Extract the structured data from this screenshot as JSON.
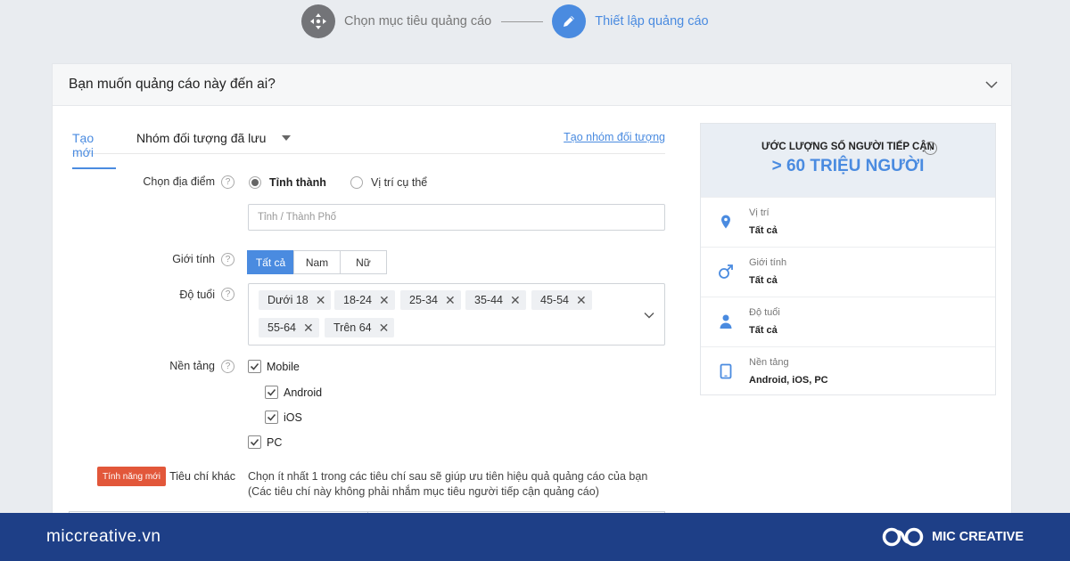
{
  "stepper": {
    "step1_label": "Chọn mục tiêu quảng cáo",
    "step2_label": "Thiết lập quảng cáo"
  },
  "card": {
    "title": "Bạn muốn quảng cáo này đến ai?"
  },
  "tabs": {
    "new_label": "Tạo mới",
    "saved_label": "Nhóm đối tượng đã lưu",
    "create_group_link": "Tạo nhóm đối tượng"
  },
  "location": {
    "label": "Chọn địa điểm",
    "option_province": "Tỉnh thành",
    "option_specific": "Vị trí cụ thể",
    "placeholder": "Tỉnh / Thành Phố"
  },
  "gender": {
    "label": "Giới tính",
    "options": [
      "Tất cả",
      "Nam",
      "Nữ"
    ]
  },
  "age": {
    "label": "Độ tuổi",
    "chips": [
      "Dưới 18",
      "18-24",
      "25-34",
      "35-44",
      "45-54",
      "55-64",
      "Trên 64"
    ]
  },
  "platform": {
    "label": "Nền tảng",
    "mobile": "Mobile",
    "android": "Android",
    "ios": "iOS",
    "pc": "PC"
  },
  "other": {
    "badge": "Tính năng mới",
    "label": "Tiêu chí khác",
    "line1": "Chọn ít nhất 1 trong các tiêu chí sau sẽ giúp ưu tiên hiệu quả quảng cáo của bạn",
    "line2": "(Các tiêu chí này không phải nhắm mục tiêu người tiếp cận quảng cáo)"
  },
  "reach": {
    "title": "ƯỚC LƯỢNG SỐ NGƯỜI TIẾP CẬN",
    "value": "> 60 TRIỆU NGƯỜI",
    "rows": [
      {
        "label": "Vị trí",
        "value": "Tất cả",
        "icon": "location-pin-icon"
      },
      {
        "label": "Giới tính",
        "value": "Tất cả",
        "icon": "male-icon"
      },
      {
        "label": "Độ tuổi",
        "value": "Tất cả",
        "icon": "person-icon"
      },
      {
        "label": "Nền tảng",
        "value": "Android, iOS, PC",
        "icon": "tablet-icon"
      }
    ]
  },
  "footer": {
    "site": "miccreative.vn",
    "brand": "MIC CREATIVE"
  },
  "colors": {
    "accent": "#4a8be0",
    "footer_bg": "#1e3f87",
    "badge": "#e2573a"
  }
}
